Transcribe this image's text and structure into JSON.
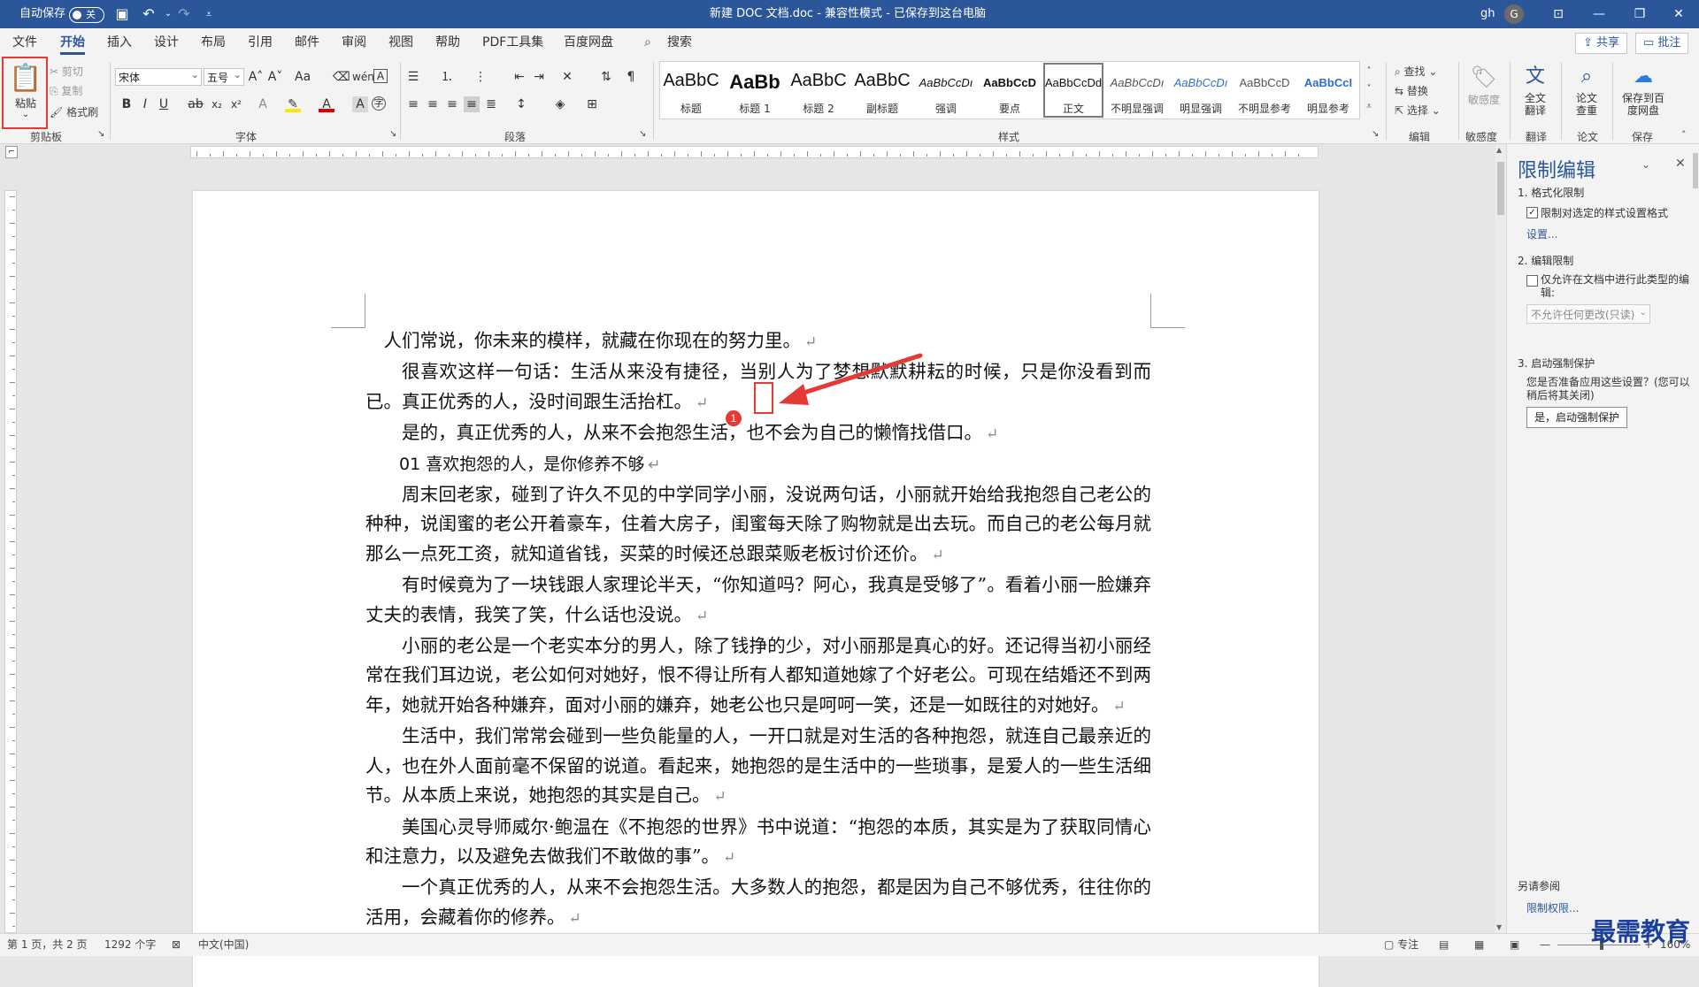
{
  "titlebar": {
    "autosave_label": "自动保存",
    "autosave_state": "关",
    "doc_title": "新建 DOC 文档.doc",
    "mode": "兼容性模式",
    "saved": "已保存到这台电脑",
    "user_initials": "gh",
    "avatar_letter": "G"
  },
  "menu": {
    "tabs": [
      "文件",
      "开始",
      "插入",
      "设计",
      "布局",
      "引用",
      "邮件",
      "审阅",
      "视图",
      "帮助",
      "PDF工具集",
      "百度网盘",
      "搜索"
    ],
    "share": "共享",
    "comment": "批注"
  },
  "ribbon": {
    "clipboard": {
      "paste": "粘贴",
      "cut": "剪切",
      "copy": "复制",
      "painter": "格式刷",
      "group": "剪贴板"
    },
    "font": {
      "name": "宋体",
      "size": "五号",
      "group": "字体"
    },
    "paragraph": {
      "group": "段落"
    },
    "styles": {
      "group": "样式",
      "items": [
        {
          "sample": "AaBbC",
          "name": "标题"
        },
        {
          "sample": "AaBb",
          "name": "标题 1"
        },
        {
          "sample": "AaBbC",
          "name": "标题 2"
        },
        {
          "sample": "AaBbC",
          "name": "副标题"
        },
        {
          "sample": "AaBbCcDı",
          "name": "强调"
        },
        {
          "sample": "AaBbCcD",
          "name": "要点"
        },
        {
          "sample": "AaBbCcDd",
          "name": "正文"
        },
        {
          "sample": "AaBbCcDı",
          "name": "不明显强调"
        },
        {
          "sample": "AaBbCcDı",
          "name": "明显强调"
        },
        {
          "sample": "AaBbCcD",
          "name": "不明显参考"
        },
        {
          "sample": "AaBbCcI",
          "name": "明显参考"
        }
      ]
    },
    "editing": {
      "find": "查找",
      "replace": "替换",
      "select": "选择",
      "group": "编辑"
    },
    "sensitivity": {
      "label": "敏感度",
      "group": "敏感度"
    },
    "translate": {
      "label": "全文翻译",
      "group": "翻译"
    },
    "paper": {
      "label": "论文查重",
      "group": "论文"
    },
    "save": {
      "label": "保存到百度网盘",
      "group": "保存"
    }
  },
  "document": {
    "paragraphs": [
      "人们常说，你未来的模样，就藏在你现在的努力里。",
      "很喜欢这样一句话：生活从来没有捷径，当别人为了梦想默默耕耘的时候，只是你没看到而已。真正优秀的人，没时间跟生活抬杠。",
      "是的，真正优秀的人，从来不会抱怨生活，也不会为自己的懒惰找借口。",
      "01  喜欢抱怨的人，是你修养不够",
      "周末回老家，碰到了许久不见的中学同学小丽，没说两句话，小丽就开始给我抱怨自己老公的种种，说闺蜜的老公开着豪车，住着大房子，闺蜜每天除了购物就是出去玩。而自己的老公每月就那么一点死工资，就知道省钱，买菜的时候还总跟菜贩老板讨价还价。",
      "有时候竟为了一块钱跟人家理论半天，“你知道吗？阿心，我真是受够了”。看着小丽一脸嫌弃丈夫的表情，我笑了笑，什么话也没说。",
      "小丽的老公是一个老实本分的男人，除了钱挣的少，对小丽那是真心的好。还记得当初小丽经常在我们耳边说，老公如何对她好，恨不得让所有人都知道她嫁了个好老公。可现在结婚还不到两年，她就开始各种嫌弃，面对小丽的嫌弃，她老公也只是呵呵一笑，还是一如既往的对她好。",
      "生活中，我们常常会碰到一些负能量的人，一开口就是对生活的各种抱怨，就连自己最亲近的人，也在外人面前毫不保留的说道。看起来，她抱怨的是生活中的一些琐事，是爱人的一些生活细节。从本质上来说，她抱怨的其实是自己。",
      "美国心灵导师威尔·鲍温在《不抱怨的世界》书中说道：“抱怨的本质，其实是为了获取同情心和注意力，以及避免去做我们不敢做的事”。",
      "一个真正优秀的人，从来不会抱怨生活。大多数人的抱怨，都是因为自己不够优秀，往往你的活用，会藏着你的修养。"
    ],
    "annotation_badge": "1"
  },
  "pane": {
    "title": "限制编辑",
    "sec1": "1. 格式化限制",
    "sec1_check": "限制对选定的样式设置格式",
    "sec1_link": "设置...",
    "sec2": "2. 编辑限制",
    "sec2_check": "仅允许在文档中进行此类型的编辑:",
    "sec2_select": "不允许任何更改(只读)",
    "sec3": "3. 启动强制保护",
    "sec3_text": "您是否准备应用这些设置？(您可以稍后将其关闭)",
    "sec3_button": "是，启动强制保护",
    "see_also": "另请参阅",
    "perm_link": "限制权限..."
  },
  "status": {
    "page": "第 1 页，共 2 页",
    "words": "1292 个字",
    "lang": "中文(中国)",
    "focus": "专注",
    "zoom": "160%"
  },
  "watermark": "最需教育",
  "colors": {
    "brand": "#2b579a",
    "highlight": "#e53935"
  }
}
